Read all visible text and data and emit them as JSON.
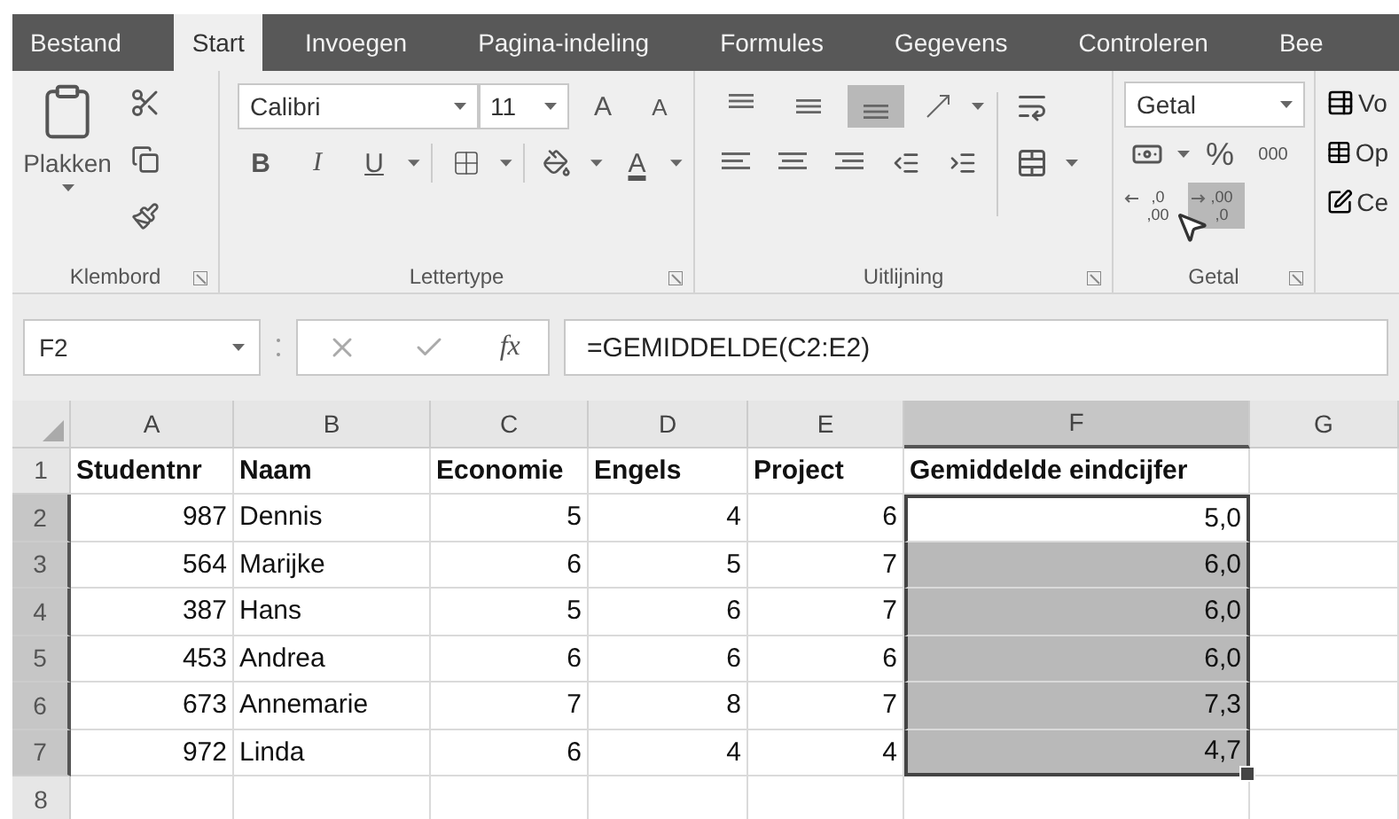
{
  "tabs": [
    {
      "label": "Bestand",
      "selected": false
    },
    {
      "label": "Start",
      "selected": true
    },
    {
      "label": "Invoegen",
      "selected": false
    },
    {
      "label": "Pagina-indeling",
      "selected": false
    },
    {
      "label": "Formules",
      "selected": false
    },
    {
      "label": "Gegevens",
      "selected": false
    },
    {
      "label": "Controleren",
      "selected": false
    },
    {
      "label": "Bee",
      "selected": false
    }
  ],
  "ribbon": {
    "clipboard": {
      "paste_label": "Plakken",
      "group_label": "Klembord"
    },
    "font": {
      "name": "Calibri",
      "size": "11",
      "grow": "A",
      "shrink": "A",
      "bold": "B",
      "italic": "I",
      "underline": "U",
      "font_color": "A",
      "group_label": "Lettertype"
    },
    "alignment": {
      "vertical": [
        {
          "kind": "top",
          "selected": false
        },
        {
          "kind": "middle",
          "selected": false
        },
        {
          "kind": "bottom",
          "selected": true
        }
      ],
      "group_label": "Uitlijning"
    },
    "number": {
      "format": "Getal",
      "percent": "%",
      "thousands": "000",
      "decimals": [
        {
          "kind": "increase",
          "upper": ",0",
          "lower": ",00",
          "hovered": false
        },
        {
          "kind": "decrease",
          "upper": ",00",
          "lower": ",0",
          "hovered": true
        }
      ],
      "group_label": "Getal"
    },
    "styles": [
      "Vo",
      "Op",
      "Ce"
    ]
  },
  "formula_bar": {
    "name_box": "F2",
    "fx": "fx",
    "formula": "=GEMIDDELDE(C2:E2)"
  },
  "sheet": {
    "columns": [
      {
        "label": "A",
        "selected": false
      },
      {
        "label": "B",
        "selected": false
      },
      {
        "label": "C",
        "selected": false
      },
      {
        "label": "D",
        "selected": false
      },
      {
        "label": "E",
        "selected": false
      },
      {
        "label": "F",
        "selected": true
      },
      {
        "label": "G",
        "selected": false
      }
    ],
    "rows": [
      {
        "number": "1",
        "selected": false,
        "kind": "header",
        "cells": [
          {
            "text": "Studentnr",
            "kind": "text",
            "selected": false
          },
          {
            "text": "Naam",
            "kind": "text",
            "selected": false
          },
          {
            "text": "Economie",
            "kind": "text",
            "selected": false
          },
          {
            "text": "Engels",
            "kind": "text",
            "selected": false
          },
          {
            "text": "Project",
            "kind": "text",
            "selected": false
          },
          {
            "text": "Gemiddelde eindcijfer",
            "kind": "text",
            "selected": false
          }
        ]
      },
      {
        "number": "2",
        "selected": true,
        "kind": "data",
        "cells": [
          {
            "text": "987",
            "kind": "number",
            "selected": false
          },
          {
            "text": "Dennis",
            "kind": "text",
            "selected": false
          },
          {
            "text": "5",
            "kind": "number",
            "selected": false
          },
          {
            "text": "4",
            "kind": "number",
            "selected": false
          },
          {
            "text": "6",
            "kind": "number",
            "selected": false
          },
          {
            "text": "5,0",
            "kind": "number",
            "selected": true,
            "active": true
          }
        ]
      },
      {
        "number": "3",
        "selected": true,
        "kind": "data",
        "cells": [
          {
            "text": "564",
            "kind": "number",
            "selected": false
          },
          {
            "text": "Marijke",
            "kind": "text",
            "selected": false
          },
          {
            "text": "6",
            "kind": "number",
            "selected": false
          },
          {
            "text": "5",
            "kind": "number",
            "selected": false
          },
          {
            "text": "7",
            "kind": "number",
            "selected": false
          },
          {
            "text": "6,0",
            "kind": "number",
            "selected": true
          }
        ]
      },
      {
        "number": "4",
        "selected": true,
        "kind": "data",
        "cells": [
          {
            "text": "387",
            "kind": "number",
            "selected": false
          },
          {
            "text": "Hans",
            "kind": "text",
            "selected": false
          },
          {
            "text": "5",
            "kind": "number",
            "selected": false
          },
          {
            "text": "6",
            "kind": "number",
            "selected": false
          },
          {
            "text": "7",
            "kind": "number",
            "selected": false
          },
          {
            "text": "6,0",
            "kind": "number",
            "selected": true
          }
        ]
      },
      {
        "number": "5",
        "selected": true,
        "kind": "data",
        "cells": [
          {
            "text": "453",
            "kind": "number",
            "selected": false
          },
          {
            "text": "Andrea",
            "kind": "text",
            "selected": false
          },
          {
            "text": "6",
            "kind": "number",
            "selected": false
          },
          {
            "text": "6",
            "kind": "number",
            "selected": false
          },
          {
            "text": "6",
            "kind": "number",
            "selected": false
          },
          {
            "text": "6,0",
            "kind": "number",
            "selected": true
          }
        ]
      },
      {
        "number": "6",
        "selected": true,
        "kind": "data",
        "cells": [
          {
            "text": "673",
            "kind": "number",
            "selected": false
          },
          {
            "text": "Annemarie",
            "kind": "text",
            "selected": false
          },
          {
            "text": "7",
            "kind": "number",
            "selected": false
          },
          {
            "text": "8",
            "kind": "number",
            "selected": false
          },
          {
            "text": "7",
            "kind": "number",
            "selected": false
          },
          {
            "text": "7,3",
            "kind": "number",
            "selected": true
          }
        ]
      },
      {
        "number": "7",
        "selected": true,
        "kind": "data",
        "cells": [
          {
            "text": "972",
            "kind": "number",
            "selected": false
          },
          {
            "text": "Linda",
            "kind": "text",
            "selected": false
          },
          {
            "text": "6",
            "kind": "number",
            "selected": false
          },
          {
            "text": "4",
            "kind": "number",
            "selected": false
          },
          {
            "text": "4",
            "kind": "number",
            "selected": false
          },
          {
            "text": "4,7",
            "kind": "number",
            "selected": true
          }
        ]
      },
      {
        "number": "8",
        "selected": false,
        "cells": []
      }
    ]
  }
}
